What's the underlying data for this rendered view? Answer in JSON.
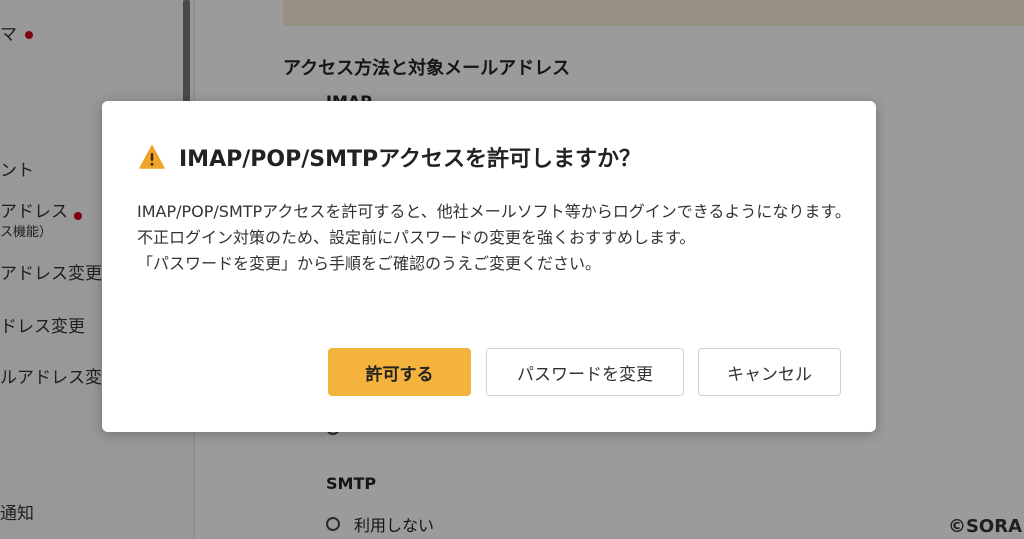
{
  "sidebar": {
    "items": [
      {
        "label": "マ",
        "dot": true
      },
      {
        "label": "ント",
        "dot": false
      },
      {
        "label": "アドレス",
        "dot": true
      },
      {
        "label": "ス機能）",
        "dot": false
      },
      {
        "label": "アドレス変更",
        "dot": false
      },
      {
        "label": "ドレス変更",
        "dot": false
      },
      {
        "label": "ルアドレス変",
        "dot": false
      },
      {
        "label": "通知",
        "dot": false
      }
    ]
  },
  "main": {
    "section_title": "アクセス方法と対象メールアドレス",
    "imap_label": "IMAP",
    "smtp_label": "SMTP",
    "smtp_option": "利用しない"
  },
  "dialog": {
    "title": "IMAP/POP/SMTPアクセスを許可しますか？",
    "body_lines": [
      "IMAP/POP/SMTPアクセスを許可すると、他社メールソフト等からログインできるようになります。",
      "不正ログイン対策のため、設定前にパスワードの変更を強くおすすめします。",
      "「パスワードを変更」から手順をご確認のうえご変更ください。"
    ],
    "buttons": {
      "allow": "許可する",
      "change_password": "パスワードを変更",
      "cancel": "キャンセル"
    }
  },
  "watermark": "©SORA",
  "colors": {
    "primary_button": "#f3b33d",
    "warning_icon": "#f0a52a",
    "required_dot": "#d0021b"
  },
  "icons": {
    "warning": "warning-triangle-icon"
  }
}
